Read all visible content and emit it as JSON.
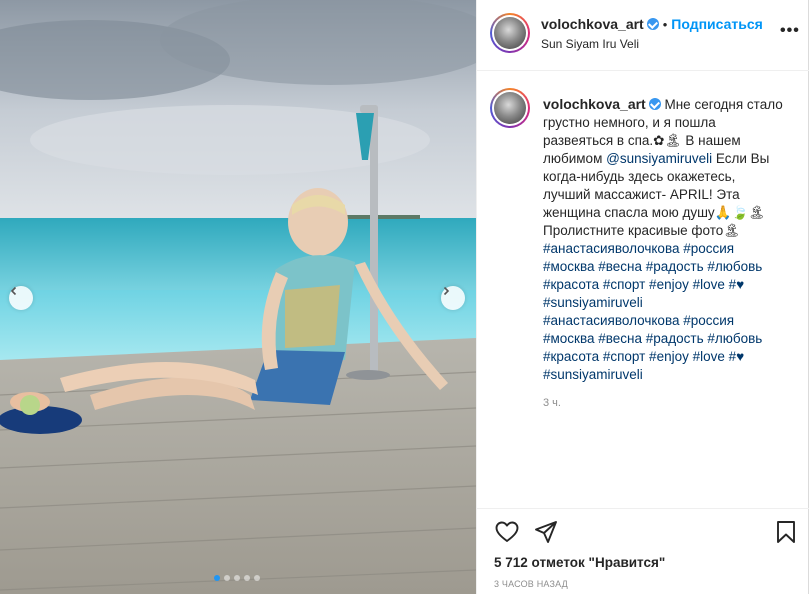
{
  "post": {
    "username": "volochkova_art",
    "location": "Sun Siyam Iru Veli",
    "follow_label": "Подписаться",
    "separator": "•",
    "more_label": "•••",
    "caption_lines": [
      "Мне сегодня стало",
      "грустно немного, и я пошла",
      "развеяться в спа.✿🏝 В нашем",
      "любимом ",
      " Если Вы",
      "когда-нибудь здесь окажетесь,",
      "лучший массажист- APRIL! Эта",
      "женщина спасла мою душу🙏🍃🏝",
      "Пролистните красивые фото🏝"
    ],
    "mention": "@sunsiyamiruveli",
    "hashtags_block_1": [
      "#анастасияволочкова #россия",
      "#москва #весна #радость #любовь",
      "#красота #спорт #enjoy #love #♥",
      "#sunsiyamiruveli"
    ],
    "hashtags_block_2": [
      "#анастасияволочкова #россия",
      "#москва #весна #радость #любовь",
      "#красота #спорт #enjoy #love #♥",
      "#sunsiyamiruveli"
    ],
    "caption_time": "3 ч.",
    "likes": "5 712 отметок \"Нравится\"",
    "posted_ago": "3 ЧАСОВ НАЗАД"
  },
  "carousel": {
    "slide_count": 5,
    "active_index": 0
  },
  "colors": {
    "accent": "#0095f6",
    "verified": "#3897f0",
    "active_dot": "#2196f3"
  },
  "icons": [
    "chevron-left-icon",
    "chevron-right-icon",
    "verified-icon",
    "more-icon",
    "heart-icon",
    "share-icon",
    "bookmark-icon"
  ]
}
